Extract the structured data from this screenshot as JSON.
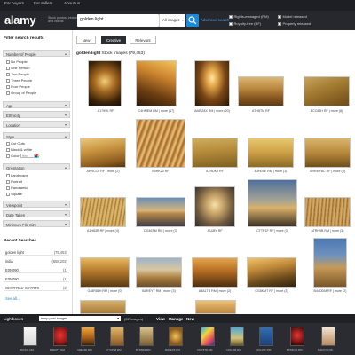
{
  "topnav": {
    "links": [
      "For buyers",
      "For sellers",
      "About us"
    ]
  },
  "header": {
    "logo": "alamy",
    "tagline": "Stock photos, vectors and videos",
    "search_value": "golden light",
    "category": "All images",
    "advanced": "Advanced search",
    "filters": [
      "Rights-managed (RM)",
      "Royalty-free (RF)",
      "Model released",
      "Property released"
    ]
  },
  "sidebar": {
    "title": "Filter search results",
    "facets": [
      {
        "label": "Number of People",
        "options": [
          "No People",
          "One Person",
          "Two People",
          "Three People",
          "Four People",
          "Group of People"
        ]
      },
      {
        "label": "Age"
      },
      {
        "label": "Ethnicity"
      },
      {
        "label": "Location"
      },
      {
        "label": "Style",
        "options": [
          "Cut Outs",
          "Black & white",
          "Color"
        ]
      },
      {
        "label": "Orientation",
        "options": [
          "Landscape",
          "Portrait",
          "Panoramic",
          "Square"
        ]
      },
      {
        "label": "Viewpoint"
      },
      {
        "label": "Date Taken"
      },
      {
        "label": "Minimum File Size"
      }
    ],
    "color_placeholder": "Hex",
    "recent_title": "Recent Searches",
    "recent": [
      {
        "term": "golden light",
        "count": "(79,453)"
      },
      {
        "term": "india",
        "count": "(658,202)"
      },
      {
        "term": "E0N090",
        "count": "(1)"
      },
      {
        "term": "E0N090",
        "count": "(1)"
      },
      {
        "term": "CXYR76 or CXYRTX",
        "count": "(2)"
      }
    ],
    "see_all": "See all..."
  },
  "main": {
    "tabs": [
      "New",
      "Creative",
      "Relevant"
    ],
    "active_tab": "Creative",
    "results_term": "golden light",
    "results_rest": "Stock Images (79,453)",
    "rows": [
      [
        "A1799K RF",
        "C4HMEM RM | more (17)",
        "AMRZ8X RM | more (20)",
        "ATH8TM RF",
        "BCC83H RF | more (8)"
      ],
      [
        "AHRCC0 RF | more (2)",
        "E0HK20 RF",
        "ATHDK9 RF",
        "B3H0TE RM | more (1)",
        "ARRMY8C RF | more (8)"
      ],
      [
        "A1H83R RF | more (4)",
        "DG46TM RM | more (3)",
        "A1U8Y RF",
        "CTTP1F RF | more (3)",
        "ATRH9B RM | more (3)"
      ],
      [
        "G48R88H RM | more (0)",
        "BAREYY RM | more (3)",
        "A8A1TB RM | more (2)",
        "CG8KMT RF | more (3)",
        "B44DDM RF | more (2)"
      ]
    ]
  },
  "lightbox": {
    "title": "Lightboxes",
    "selected": "temp post images",
    "count": "(22 images)",
    "actions": [
      "View",
      "Manage",
      "New"
    ],
    "thumbs": [
      "B6XJ01 RM",
      "B8ERTT RM",
      "A9EC60 RM",
      "CY0P58 RM",
      "BT8AB3 RM",
      "B3KEX5 RM",
      "CMY8T8 RM",
      "CPH195 RM",
      "CPH1TK RM",
      "B9T8CW RM",
      "B4D7CW RF"
    ]
  }
}
